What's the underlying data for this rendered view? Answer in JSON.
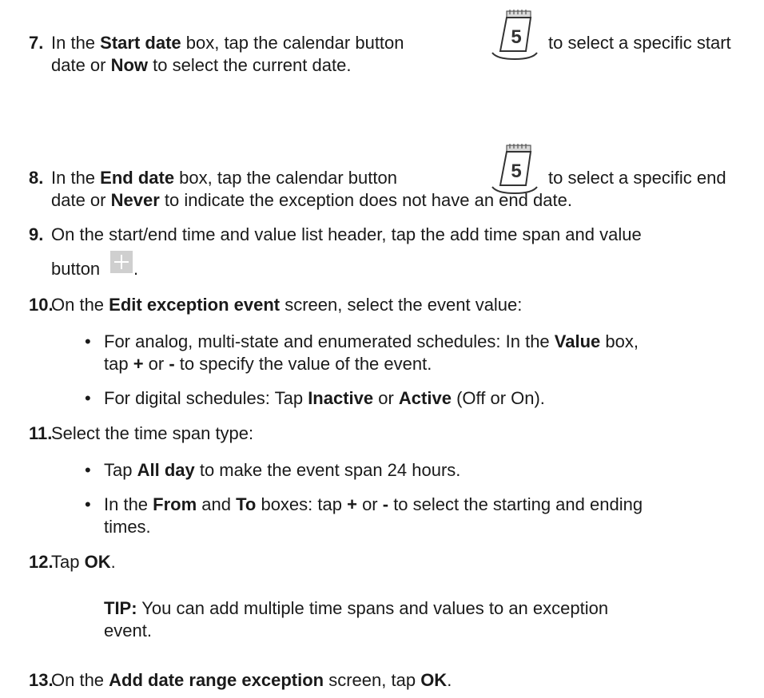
{
  "steps": {
    "s7": {
      "num": "7.",
      "a": "In the ",
      "b1": "Start date",
      "c": " box, tap the calendar button",
      "d": "to select a specific start",
      "e": "date or ",
      "b2": "Now",
      "f": " to select the current date."
    },
    "s8": {
      "num": "8.",
      "a": "In the ",
      "b1": "End date",
      "c": " box, tap the calendar button",
      "d": "to select a specific end",
      "e": "date or ",
      "b2": "Never",
      "f": " to indicate the exception does not have an end date."
    },
    "s9": {
      "num": "9.",
      "a": "On the start/end time and value list header, tap the add time span and value",
      "e": "button",
      "f": "."
    },
    "s10": {
      "num": "10.",
      "a": "On the ",
      "b1": "Edit exception event",
      "c": " screen, select the event value:",
      "bul1": {
        "a": "For analog, multi-state and enumerated schedules: In the ",
        "b1": "Value",
        "c": " box,",
        "d": "tap ",
        "b2": "+",
        "e": " or ",
        "b3": "-",
        "f": " to specify the value of the event."
      },
      "bul2": {
        "a": "For digital schedules: Tap ",
        "b1": "Inactive",
        "c": " or ",
        "b2": "Active",
        "d": " (Off or On)."
      }
    },
    "s11": {
      "num": "11.",
      "a": "Select the time span type:",
      "bul1": {
        "a": "Tap ",
        "b1": "All day",
        "c": " to make the event span 24 hours."
      },
      "bul2": {
        "a": "In the ",
        "b1": "From",
        "c": " and ",
        "b2": "To",
        "d": " boxes: tap ",
        "b3": "+",
        "e": " or ",
        "b4": "-",
        "f": " to select the starting and ending",
        "g": "times."
      }
    },
    "s12": {
      "num": "12.",
      "a": "Tap ",
      "b1": "OK",
      "c": ".",
      "tip": {
        "label": "TIP:",
        "text": " You can add multiple time spans and values to an exception",
        "text2": "event."
      }
    },
    "s13": {
      "num": "13.",
      "a": "On the ",
      "b1": "Add date range exception",
      "c": " screen, tap ",
      "b2": "OK",
      "d": "."
    }
  },
  "bullet": "•",
  "icons": {
    "calendar_day": "5"
  }
}
